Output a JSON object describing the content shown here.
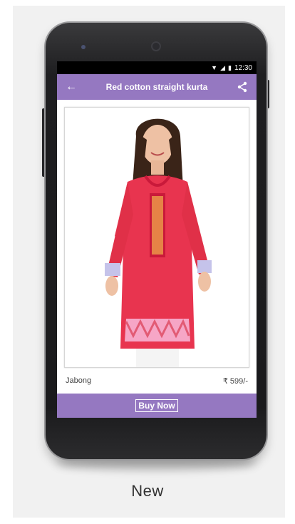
{
  "status_bar": {
    "time": "12:30"
  },
  "app_bar": {
    "title": "Red cotton straight kurta"
  },
  "product": {
    "brand": "Jabong",
    "price": "₹ 599/-"
  },
  "actions": {
    "buy_label": "Buy Now"
  },
  "caption": "New",
  "colors": {
    "accent": "#9578c1",
    "kurta": "#e8344f",
    "background": "#f1f1f1"
  },
  "icons": [
    "back-arrow-icon",
    "share-icon",
    "wifi-icon",
    "signal-icon",
    "battery-icon"
  ]
}
